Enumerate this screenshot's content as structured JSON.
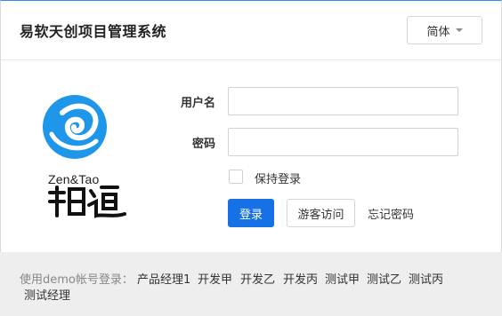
{
  "header": {
    "title": "易软天创项目管理系统",
    "language_label": "简体"
  },
  "logo": {
    "latin_text": "Zen&Tao",
    "seal_text": "禪道",
    "accent_color": "#1e96ea"
  },
  "form": {
    "username_label": "用户名",
    "username_value": "",
    "password_label": "密码",
    "password_value": "",
    "remember_label": "保持登录",
    "remember_checked": false,
    "login_label": "登录",
    "guest_label": "游客访问",
    "forgot_label": "忘记密码"
  },
  "footer": {
    "prefix": "使用demo帐号登录：",
    "users": [
      "产品经理1",
      "开发甲",
      "开发乙",
      "开发丙",
      "测试甲",
      "测试乙",
      "测试丙",
      "测试经理"
    ]
  },
  "colors": {
    "primary": "#1671e6",
    "footer_bg": "#eeeeee"
  }
}
